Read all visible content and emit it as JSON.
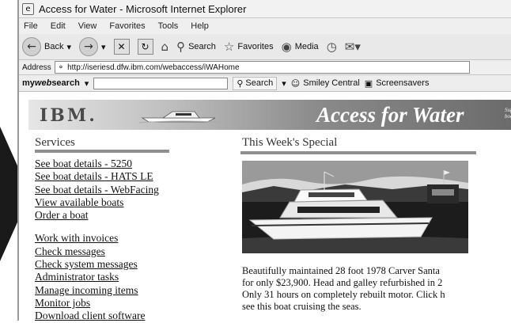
{
  "window": {
    "title": "Access for Water - Microsoft Internet Explorer"
  },
  "menu": {
    "items": [
      "File",
      "Edit",
      "View",
      "Favorites",
      "Tools",
      "Help"
    ]
  },
  "toolbar": {
    "back_label": "Back",
    "search_label": "Search",
    "favorites_label": "Favorites",
    "media_label": "Media"
  },
  "address": {
    "label": "Address",
    "url": "http://iseriesd.dfw.ibm.com/webaccess/iWAHome"
  },
  "searchbar": {
    "brand_prefix": "my",
    "brand_emphasis": "web",
    "brand_suffix": "search",
    "search_label": "Search",
    "smiley_label": "Smiley Central",
    "screensavers_label": "Screensavers"
  },
  "banner": {
    "logo": "IBM.",
    "title": "Access for Water",
    "subtitle_line1": "Sup",
    "subtitle_line2": "boat"
  },
  "services": {
    "heading": "Services",
    "links_group1": [
      "See boat details - 5250",
      "See boat details - HATS LE",
      "See boat details - WebFacing",
      "View available boats",
      "Order a boat"
    ],
    "links_group2": [
      "Work with invoices",
      "Check messages",
      "Check system messages",
      "Administrator tasks",
      "Manage incoming items",
      "Monitor jobs",
      "Download client software"
    ]
  },
  "special": {
    "heading": "This Week's Special",
    "description_lines": [
      "Beautifully maintained 28 foot 1978 Carver Santa",
      "for only $23,900. Head and galley refurbished in 2",
      "Only 31 hours on completely rebuilt motor. Click h",
      "see this boat cruising the seas."
    ]
  },
  "colors": {
    "rule": "#8f8f8f",
    "banner_dark": "#6b6b6b",
    "page_bg": "#ffffff"
  }
}
